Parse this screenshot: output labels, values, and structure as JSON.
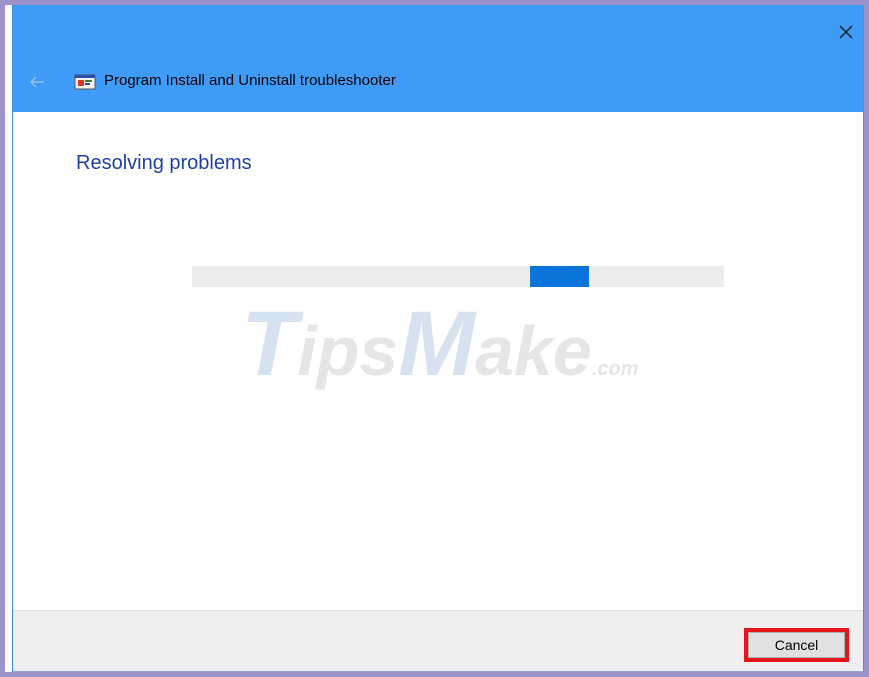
{
  "window": {
    "title": "Program Install and Uninstall troubleshooter",
    "titlebar_color": "#3e9cf8"
  },
  "icons": {
    "close": "close-icon",
    "back": "back-arrow-icon",
    "app": "troubleshooter-icon"
  },
  "main": {
    "heading": "Resolving problems",
    "heading_color": "#1f3fa6",
    "progress": {
      "indeterminate": true,
      "bar_color": "#0a74d9",
      "track_color": "#ececec"
    }
  },
  "watermark": {
    "t": "T",
    "ips": "ips",
    "m": "M",
    "ake": "ake",
    "com": ".com"
  },
  "footer": {
    "cancel_label": "Cancel",
    "highlight_color": "#e3161e"
  }
}
